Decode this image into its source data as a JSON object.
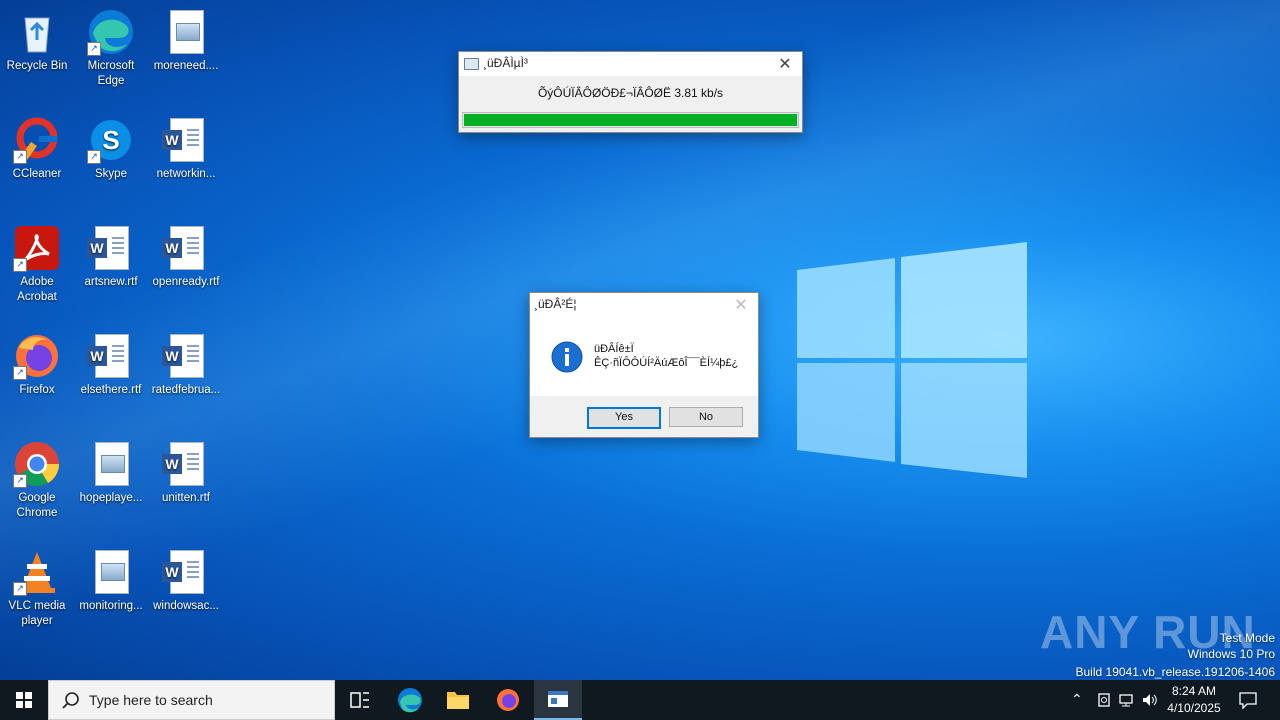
{
  "desktop": {
    "icons": [
      {
        "label": "Recycle Bin",
        "icon": "recycle-bin-icon"
      },
      {
        "label": "Microsoft Edge",
        "icon": "edge-icon"
      },
      {
        "label": "moreneed....",
        "icon": "image-file-icon"
      },
      {
        "label": "CCleaner",
        "icon": "ccleaner-icon"
      },
      {
        "label": "Skype",
        "icon": "skype-icon"
      },
      {
        "label": "networkin...",
        "icon": "word-doc-icon"
      },
      {
        "label": "Adobe Acrobat",
        "icon": "acrobat-icon"
      },
      {
        "label": "artsnew.rtf",
        "icon": "word-doc-icon"
      },
      {
        "label": "openready.rtf",
        "icon": "word-doc-icon"
      },
      {
        "label": "Firefox",
        "icon": "firefox-icon"
      },
      {
        "label": "elsethere.rtf",
        "icon": "word-doc-icon"
      },
      {
        "label": "ratedfebrua...",
        "icon": "word-doc-icon"
      },
      {
        "label": "Google Chrome",
        "icon": "chrome-icon"
      },
      {
        "label": "hopeplaye...",
        "icon": "image-file-icon"
      },
      {
        "label": "unitten.rtf",
        "icon": "word-doc-icon"
      },
      {
        "label": "VLC media player",
        "icon": "vlc-icon"
      },
      {
        "label": "monitoring...",
        "icon": "image-file-icon"
      },
      {
        "label": "windowsac...",
        "icon": "word-doc-icon"
      }
    ]
  },
  "download_window": {
    "title": "¸üÐÂÌµÌ³",
    "status": "ÕýÔÚÏÂÔØÖÐ£¬ÏÂÔØË  3.81  kb/s",
    "progress": 1.0,
    "progress_color": "#06b025"
  },
  "message_box": {
    "title": "¸üÐÂ²É¦",
    "line1": "üÐÂÍê±Ï",
    "line2": "ÊÇ·ñÏÔÔÚÍ²ÄúÆôÎ¯¯ÈÍ¼þ£¿",
    "yes_label": "Yes",
    "no_label": "No",
    "icon": "info-icon"
  },
  "taskbar": {
    "search_placeholder": "Type here to search",
    "time": "8:24 AM",
    "date": "4/10/2025"
  },
  "watermark": {
    "brand": "ANY RUN",
    "line1": "Test Mode",
    "line2": "Windows 10 Pro",
    "line3": "Build 19041.vb_release.191206-1406"
  }
}
